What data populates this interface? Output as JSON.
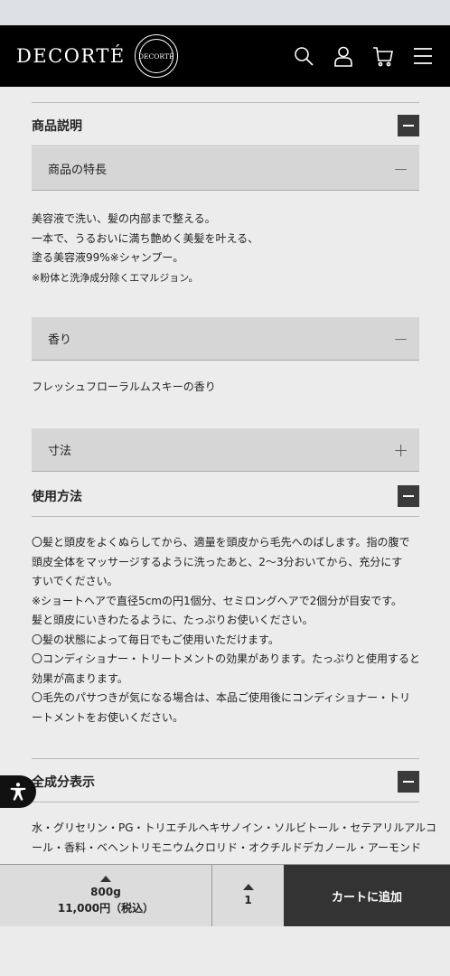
{
  "header": {
    "logo": "DECORTÉ",
    "seal_text": "DECORTÉ",
    "icons": [
      "search-icon",
      "account-icon",
      "cart-icon",
      "menu-icon"
    ]
  },
  "sections": {
    "description": {
      "title": "商品説明",
      "features": {
        "title": "商品の特長",
        "sign": "−",
        "lines": [
          "美容液で洗い、髪の内部まで整える。",
          "一本で、うるおいに満ち艶めく美髪を叶える、",
          "塗る美容液99%※シャンプー。",
          "※粉体と洗浄成分除くエマルジョン。"
        ]
      },
      "scent": {
        "title": "香り",
        "sign": "−",
        "text": "フレッシュフローラルムスキーの香り"
      },
      "size": {
        "title": "寸法",
        "sign": "+"
      }
    },
    "usage": {
      "title": "使用方法",
      "lines": [
        "〇髪と頭皮をよくぬらしてから、適量を頭皮から毛先へのばします。指の腹で",
        "頭皮全体をマッサージするように洗ったあと、2〜3分おいてから、充分にす",
        "すいでください。",
        "※ショートヘアで直径5cmの円1個分、セミロングヘアで2個分が目安です。",
        "髪と頭皮にいきわたるように、たっぷりお使いください。",
        "〇髪の状態によって毎日でもご使用いただけます。",
        "〇コンディショナー・トリートメントの効果があります。たっぷりと使用すると",
        "効果が高まります。",
        "〇毛先のパサつきが気になる場合は、本品ご使用後にコンディショナー・トリ",
        "ートメントをお使いください。"
      ]
    },
    "ingredients": {
      "title": "全成分表示",
      "lines": [
        "水・グリセリン・PG・トリエチルヘキサノイン・ソルビトール・セテアリルアルコ",
        "ール・香料・ベヘントリモニウムクロリド・オクチルドデカノール・アーモンド"
      ]
    }
  },
  "bottom_bar": {
    "size": "800g",
    "price": "11,000円（税込）",
    "quantity": "1",
    "add_to_cart": "カートに追加"
  }
}
